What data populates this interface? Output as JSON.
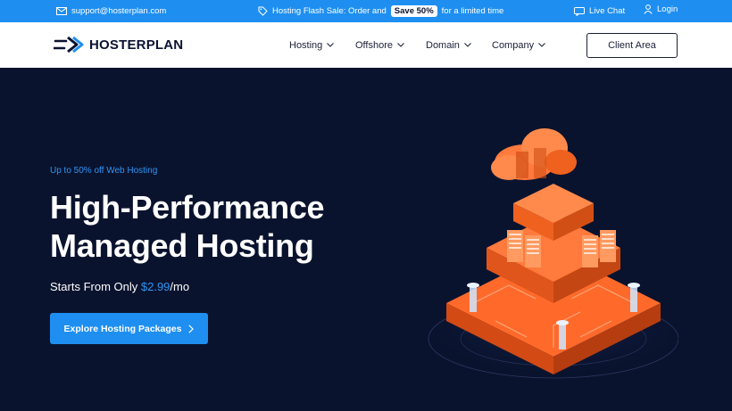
{
  "topbar": {
    "email": "support@hosterplan.com",
    "promo_prefix": "Hosting Flash Sale: Order and",
    "promo_badge": "Save 50%",
    "promo_suffix": "for a limited time",
    "live_chat": "Live Chat",
    "login": "Login"
  },
  "header": {
    "logo_text": "HOSTERPLAN",
    "nav": [
      {
        "label": "Hosting"
      },
      {
        "label": "Offshore"
      },
      {
        "label": "Domain"
      },
      {
        "label": "Company"
      }
    ],
    "client_area": "Client Area"
  },
  "hero": {
    "eyebrow": "Up to 50% off Web Hosting",
    "title_line1": "High-Performance",
    "title_line2": "Managed Hosting",
    "price_prefix": "Starts From Only",
    "price_amount": "$2.99",
    "price_suffix": "/mo",
    "cta_label": "Explore Hosting Packages"
  },
  "icons": [
    "mail-icon",
    "tag-icon",
    "chat-icon",
    "user-icon",
    "chevron-down-icon",
    "chevron-right-icon",
    "logo-icon"
  ],
  "colors": {
    "accent": "#1e8ff0",
    "hero_bg": "#0a132e",
    "art_orange": "#ff6a2b"
  }
}
